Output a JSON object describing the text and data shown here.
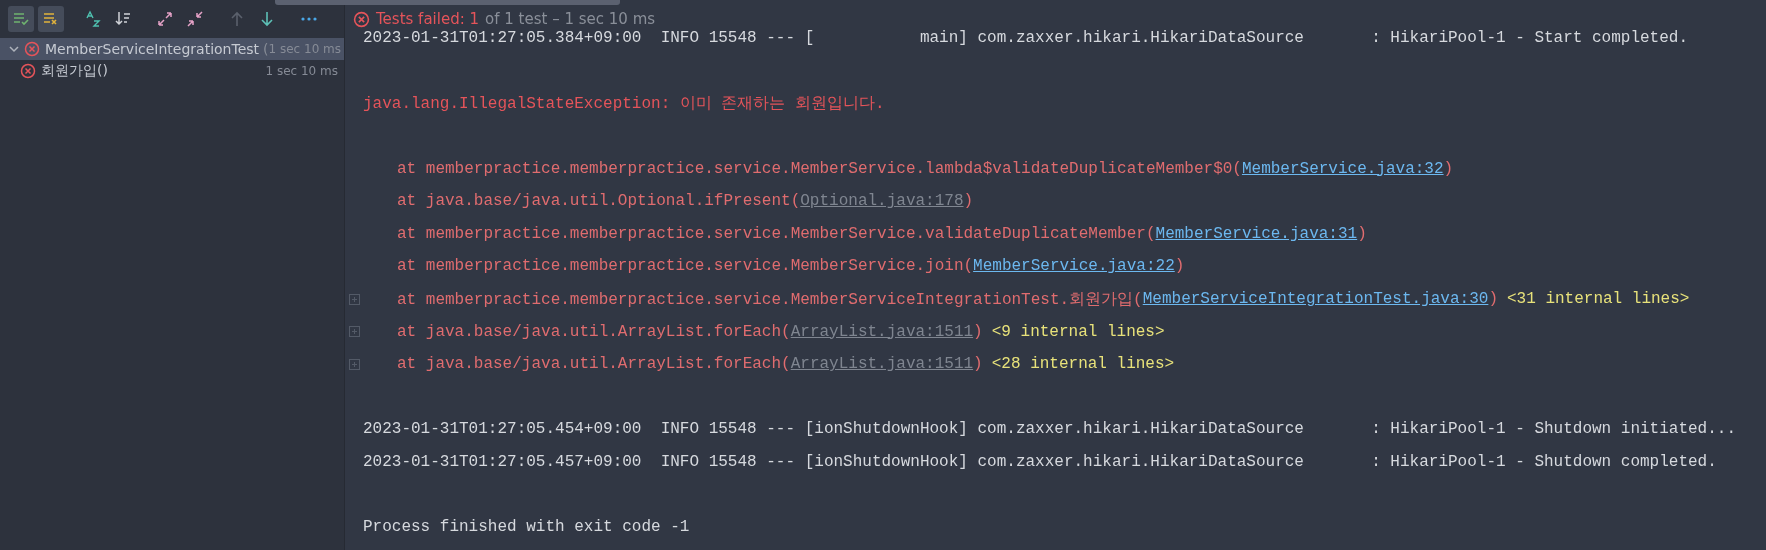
{
  "toolbar": {
    "buttons": [
      {
        "kind": "show-passed",
        "on": true
      },
      {
        "kind": "show-ignored",
        "on": true
      },
      {
        "kind": "sort-alpha",
        "on": false
      },
      {
        "kind": "sort-duration",
        "on": false
      },
      {
        "kind": "expand-all",
        "on": false
      },
      {
        "kind": "collapse-all",
        "on": false
      },
      {
        "kind": "previous",
        "disabled": true
      },
      {
        "kind": "next",
        "disabled": false
      },
      {
        "kind": "more"
      }
    ]
  },
  "status": {
    "failed_label": "Tests failed: 1",
    "summary": "of 1 test – 1 sec 10 ms"
  },
  "tree": [
    {
      "name": "MemberServiceIntegrationTest",
      "location": "(",
      "duration": "1 sec 10 ms",
      "failed": true,
      "expanded": true,
      "selected": true,
      "children": [
        {
          "name": "회원가입()",
          "duration": "1 sec 10 ms",
          "failed": true,
          "selected": false
        }
      ]
    }
  ],
  "console": [
    {
      "kind": "log",
      "text": "2023-01-31T01:27:05.384+09:00  INFO 15548 --- [           main] com.zaxxer.hikari.HikariDataSource       : HikariPool-1 - Start completed."
    },
    {
      "kind": "blank"
    },
    {
      "kind": "exception",
      "text": "java.lang.IllegalStateException: 이미 존재하는 회원입니다."
    },
    {
      "kind": "blank"
    },
    {
      "kind": "frame",
      "text": "at memberpractice.memberpractice.service.MemberService.lambda$validateDuplicateMember$0(",
      "link": "MemberService.java:32",
      "in_project": true,
      "close": ")"
    },
    {
      "kind": "frame",
      "text": "at java.base/java.util.Optional.ifPresent(",
      "link": "Optional.java:178",
      "in_project": false,
      "close": ")"
    },
    {
      "kind": "frame",
      "text": "at memberpractice.memberpractice.service.MemberService.validateDuplicateMember(",
      "link": "MemberService.java:31",
      "in_project": true,
      "close": ")"
    },
    {
      "kind": "frame",
      "text": "at memberpractice.memberpractice.service.MemberService.join(",
      "link": "MemberService.java:22",
      "in_project": true,
      "close": ")"
    },
    {
      "kind": "frame",
      "text": "at memberpractice.memberpractice.service.MemberServiceIntegrationTest.회원가입(",
      "link": "MemberServiceIntegrationTest.java:30",
      "in_project": true,
      "close": ")",
      "internal": "<31 internal lines>"
    },
    {
      "kind": "frame",
      "text": "at java.base/java.util.ArrayList.forEach(",
      "link": "ArrayList.java:1511",
      "in_project": false,
      "close": ")",
      "internal": "<9 internal lines>"
    },
    {
      "kind": "frame",
      "text": "at java.base/java.util.ArrayList.forEach(",
      "link": "ArrayList.java:1511",
      "in_project": false,
      "close": ")",
      "internal": "<28 internal lines>"
    },
    {
      "kind": "blank"
    },
    {
      "kind": "log",
      "text": "2023-01-31T01:27:05.454+09:00  INFO 15548 --- [ionShutdownHook] com.zaxxer.hikari.HikariDataSource       : HikariPool-1 - Shutdown initiated..."
    },
    {
      "kind": "log",
      "text": "2023-01-31T01:27:05.457+09:00  INFO 15548 --- [ionShutdownHook] com.zaxxer.hikari.HikariDataSource       : HikariPool-1 - Shutdown completed."
    },
    {
      "kind": "blank"
    },
    {
      "kind": "log",
      "text": "Process finished with exit code -1"
    }
  ]
}
